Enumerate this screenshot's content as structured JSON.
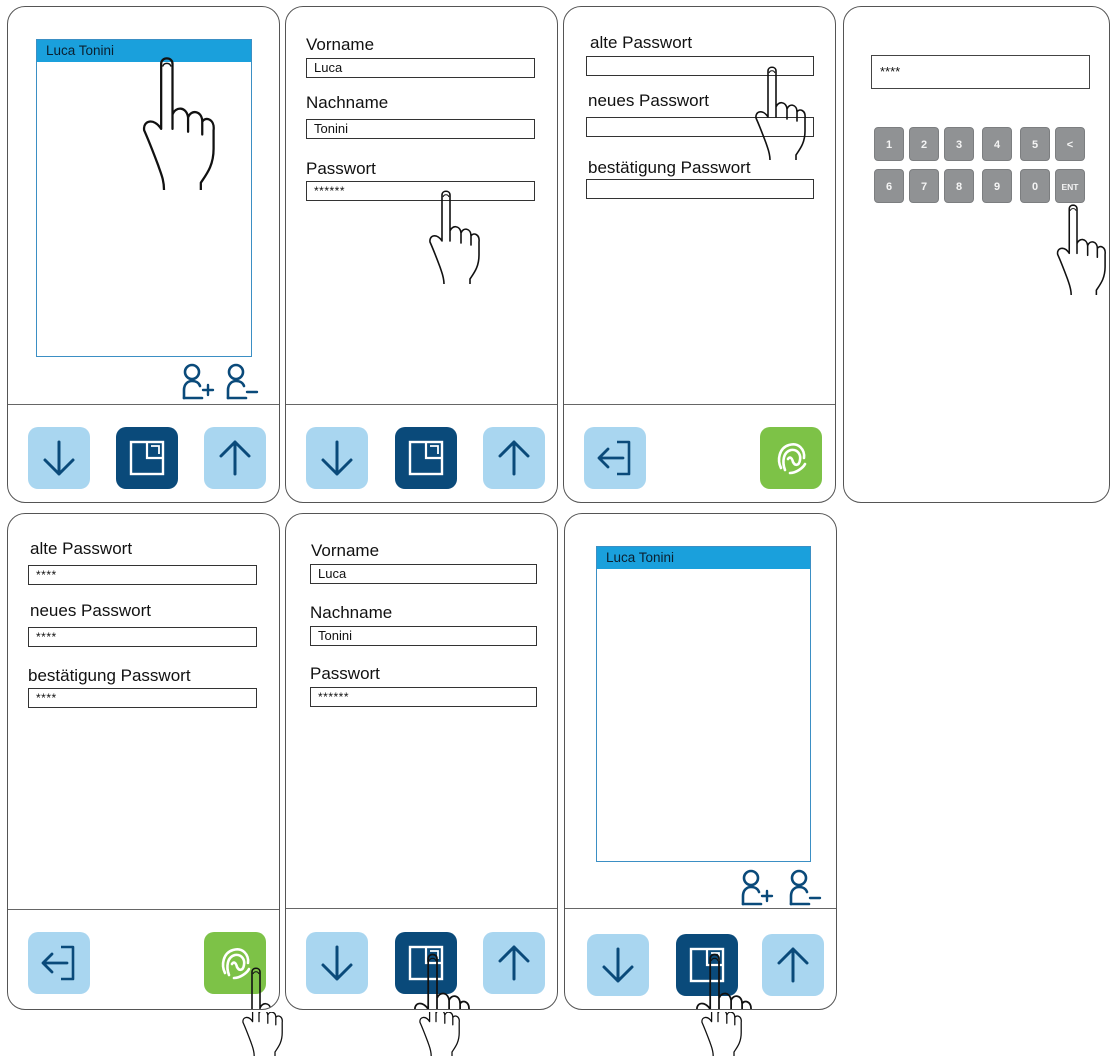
{
  "screens": {
    "s1": {
      "list_items": [
        "Luca Tonini"
      ]
    },
    "s2": {
      "vorname_label": "Vorname",
      "vorname_value": "Luca",
      "nachname_label": "Nachname",
      "nachname_value": "Tonini",
      "passwort_label": "Passwort",
      "passwort_value": "******"
    },
    "s3": {
      "old_label": "alte Passwort",
      "old_value": "",
      "new_label": "neues Passwort",
      "new_value": "",
      "confirm_label": "bestätigung Passwort",
      "confirm_value": ""
    },
    "s4": {
      "pin_value": "****",
      "keys_row1": [
        "1",
        "2",
        "3",
        "4",
        "5",
        "<"
      ],
      "keys_row2": [
        "6",
        "7",
        "8",
        "9",
        "0",
        "ENT"
      ]
    },
    "s5": {
      "old_label": "alte Passwort",
      "old_value": "****",
      "new_label": "neues Passwort",
      "new_value": "****",
      "confirm_label": "bestätigung Passwort",
      "confirm_value": "****"
    },
    "s6": {
      "vorname_label": "Vorname",
      "vorname_value": "Luca",
      "nachname_label": "Nachname",
      "nachname_value": "Tonini",
      "passwort_label": "Passwort",
      "passwort_value": "******"
    },
    "s7": {
      "list_items": [
        "Luca Tonini"
      ]
    }
  },
  "icons": {
    "down": "arrow-down-icon",
    "up": "arrow-up-icon",
    "center": "key-card-icon",
    "back": "back-arrow-icon",
    "confirm": "fingerprint-icon",
    "add_user": "add-user-icon",
    "remove_user": "remove-user-icon",
    "pointer": "hand-pointer-icon"
  },
  "colors": {
    "list_highlight": "#1aa0dc",
    "button_light": "#a9d6f0",
    "button_dark": "#0a4a7a",
    "button_green": "#7dc247",
    "icon_blue": "#0a4a7a",
    "key_gray": "#909294"
  }
}
